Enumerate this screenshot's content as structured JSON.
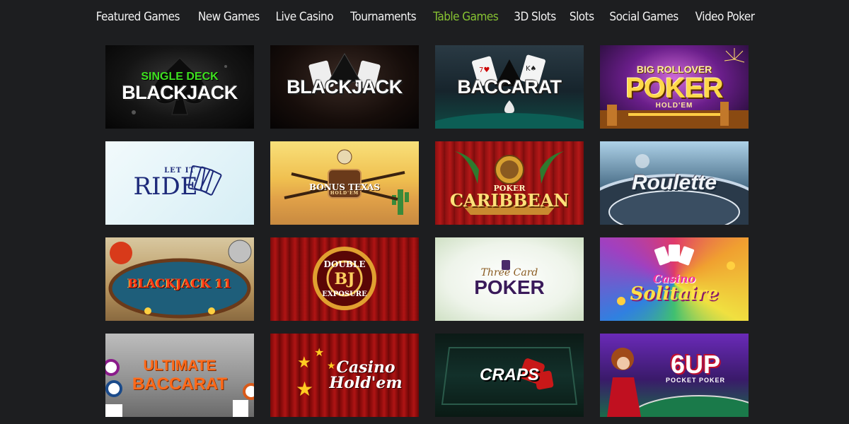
{
  "nav": {
    "items": [
      {
        "label": "Featured Games"
      },
      {
        "label": "New Games"
      },
      {
        "label": "Live Casino"
      },
      {
        "label": "Tournaments"
      },
      {
        "label": "Table Games",
        "active": true
      },
      {
        "label": "3D Slots"
      },
      {
        "label": "Slots"
      },
      {
        "label": "Social Games"
      },
      {
        "label": "Video Poker"
      }
    ],
    "active_color": "#86c232"
  },
  "games": [
    {
      "title": "BLACKJACK",
      "subtitle": "SINGLE DECK"
    },
    {
      "title": "BLACKJACK"
    },
    {
      "title": "BACCARAT"
    },
    {
      "title": "POKER",
      "subtitle": "BIG ROLLOVER",
      "tag": "HOLD'EM"
    },
    {
      "title": "RIDE",
      "subtitle": "LET IT"
    },
    {
      "title": "BONUS TEXAS",
      "tag": "HOLD'EM"
    },
    {
      "title": "CARIBBEAN",
      "subtitle": "POKER"
    },
    {
      "title": "Roulette"
    },
    {
      "title": "BLACKJACK 11"
    },
    {
      "title": "DOUBLE",
      "logo": "BJ",
      "tag": "EXPOSURE"
    },
    {
      "title": "POKER",
      "subtitle": "Three Card"
    },
    {
      "title": "Solitaire",
      "subtitle": "Casino"
    },
    {
      "title": "ULTIMATE",
      "tag": "BACCARAT"
    },
    {
      "title": "Casino",
      "tag": "Hold'em"
    },
    {
      "title": "CRAPS"
    },
    {
      "title": "6UP",
      "tag": "POCKET POKER"
    }
  ]
}
